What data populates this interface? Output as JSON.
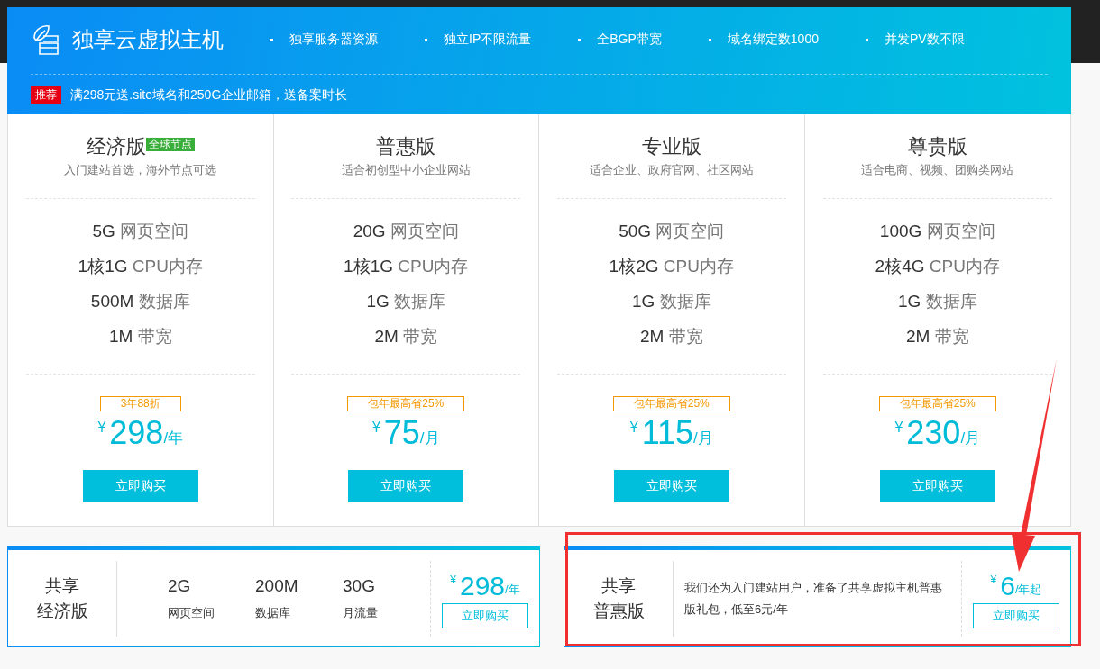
{
  "banner": {
    "title": "独享云虚拟主机",
    "features": [
      "独享服务器资源",
      "独立IP不限流量",
      "全BGP带宽",
      "域名绑定数1000",
      "并发PV数不限"
    ],
    "promo": {
      "badge": "推荐",
      "text": "满298元送.site域名和250G企业邮箱，送备案时长"
    }
  },
  "plans": [
    {
      "name": "经济版",
      "tag": "全球节点",
      "subtitle": "入门建站首选，海外节点可选",
      "specs": [
        {
          "amount": "5G",
          "label": "网页空间"
        },
        {
          "amount": "1核1G",
          "label": "CPU内存"
        },
        {
          "amount": "500M",
          "label": "数据库"
        },
        {
          "amount": "1M",
          "label": "带宽"
        }
      ],
      "discount": "3年88折",
      "currency": "¥",
      "price": "298",
      "unit": "/年",
      "button": "立即购买"
    },
    {
      "name": "普惠版",
      "subtitle": "适合初创型中小企业网站",
      "specs": [
        {
          "amount": "20G",
          "label": "网页空间"
        },
        {
          "amount": "1核1G",
          "label": "CPU内存"
        },
        {
          "amount": "1G",
          "label": "数据库"
        },
        {
          "amount": "2M",
          "label": "带宽"
        }
      ],
      "discount": "包年最高省25%",
      "currency": "¥",
      "price": "75",
      "unit": "/月",
      "button": "立即购买"
    },
    {
      "name": "专业版",
      "subtitle": "适合企业、政府官网、社区网站",
      "specs": [
        {
          "amount": "50G",
          "label": "网页空间"
        },
        {
          "amount": "1核2G",
          "label": "CPU内存"
        },
        {
          "amount": "1G",
          "label": "数据库"
        },
        {
          "amount": "2M",
          "label": "带宽"
        }
      ],
      "discount": "包年最高省25%",
      "currency": "¥",
      "price": "115",
      "unit": "/月",
      "button": "立即购买"
    },
    {
      "name": "尊贵版",
      "subtitle": "适合电商、视频、团购类网站",
      "specs": [
        {
          "amount": "100G",
          "label": "网页空间"
        },
        {
          "amount": "2核4G",
          "label": "CPU内存"
        },
        {
          "amount": "1G",
          "label": "数据库"
        },
        {
          "amount": "2M",
          "label": "带宽"
        }
      ],
      "discount": "包年最高省25%",
      "currency": "¥",
      "price": "230",
      "unit": "/月",
      "button": "立即购买"
    }
  ],
  "shared": [
    {
      "kind": "specs",
      "name": [
        "共享",
        "经济版"
      ],
      "specs": [
        {
          "value": "2G",
          "label": "网页空间"
        },
        {
          "value": "200M",
          "label": "数据库"
        },
        {
          "value": "30G",
          "label": "月流量"
        }
      ],
      "currency": "¥",
      "price": "298",
      "unit": "/年",
      "button": "立即购买",
      "highlighted": false
    },
    {
      "kind": "text",
      "name": [
        "共享",
        "普惠版"
      ],
      "description": "我们还为入门建站用户，准备了共享虚拟主机普惠版礼包，低至6元/年",
      "currency": "¥",
      "price": "6",
      "unit": "/年起",
      "button": "立即购买",
      "highlighted": true
    }
  ]
}
